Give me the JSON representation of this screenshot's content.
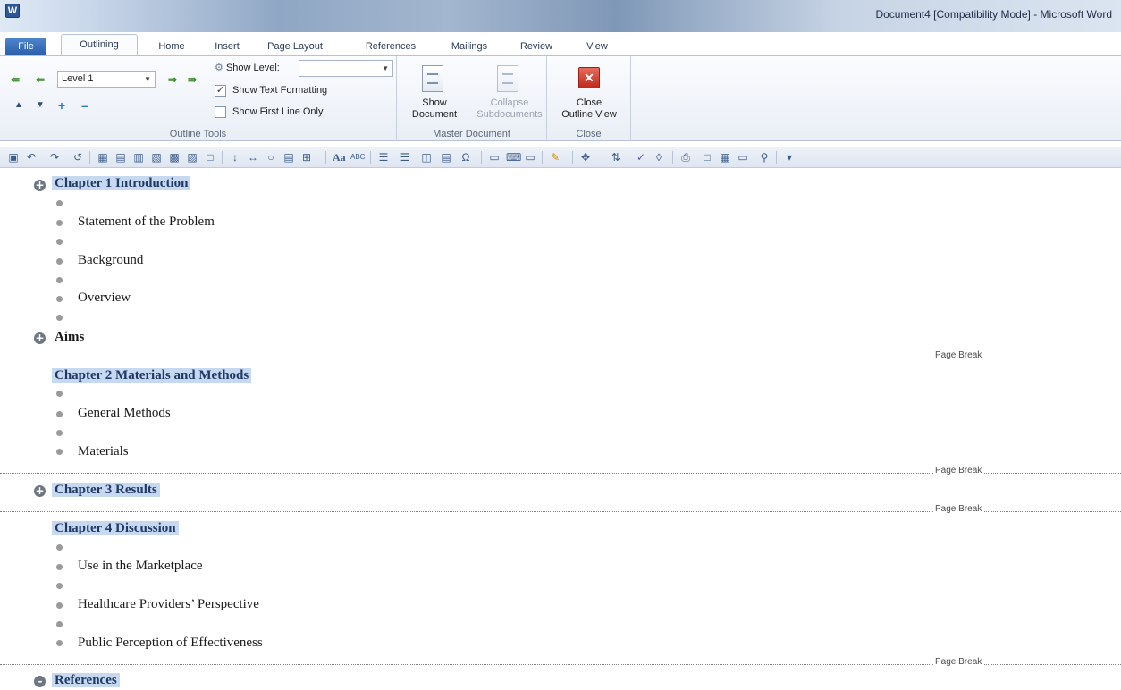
{
  "window": {
    "app_icon": "W",
    "title": "Document4 [Compatibility Mode] - Microsoft Word"
  },
  "tabs": [
    "File",
    "Outlining",
    "Home",
    "Insert",
    "Page Layout",
    "References",
    "Mailings",
    "Review",
    "View"
  ],
  "ribbon": {
    "outline_tools": {
      "label": "Outline Tools",
      "level_value": "Level 1",
      "show_level_label": "Show Level:",
      "show_level_value": "",
      "show_text_formatting": "Show Text Formatting",
      "show_text_formatting_checked": true,
      "show_first_line_only": "Show First Line Only",
      "show_first_line_only_checked": false
    },
    "master_document": {
      "label": "Master Document",
      "show_document_line1": "Show",
      "show_document_line2": "Document",
      "collapse_line1": "Collapse",
      "collapse_line2": "Subdocuments"
    },
    "close": {
      "label": "Close",
      "close_line1": "Close",
      "close_line2": "Outline View"
    }
  },
  "document": {
    "page_break_label": "Page Break",
    "chapter1": "Chapter 1 Introduction",
    "c1_items": [
      "Statement of the Problem",
      "Background",
      "Overview"
    ],
    "aims": "Aims",
    "chapter2": "Chapter 2 Materials and Methods",
    "c2_items": [
      "General Methods",
      "Materials"
    ],
    "chapter3": "Chapter 3 Results",
    "chapter4": "Chapter 4 Discussion",
    "c4_items": [
      "Use in the Marketplace",
      "Healthcare Providers’ Perspective",
      "Public Perception of Effectiveness"
    ],
    "references": "References"
  },
  "colors": {
    "heading_highlight": "#c6d9f1",
    "heading_text": "#1f3864",
    "file_tab": "#2a5ea8",
    "close_red": "#c1281a"
  },
  "icons": [
    "word-app-icon",
    "promote-to-heading-icon",
    "promote-icon",
    "demote-icon",
    "demote-to-body-icon",
    "move-up-icon",
    "move-down-icon",
    "expand-icon",
    "collapse-icon",
    "show-document-icon",
    "collapse-subdocuments-icon",
    "close-outline-icon",
    "expand-outline-icon",
    "bullet-icon"
  ]
}
